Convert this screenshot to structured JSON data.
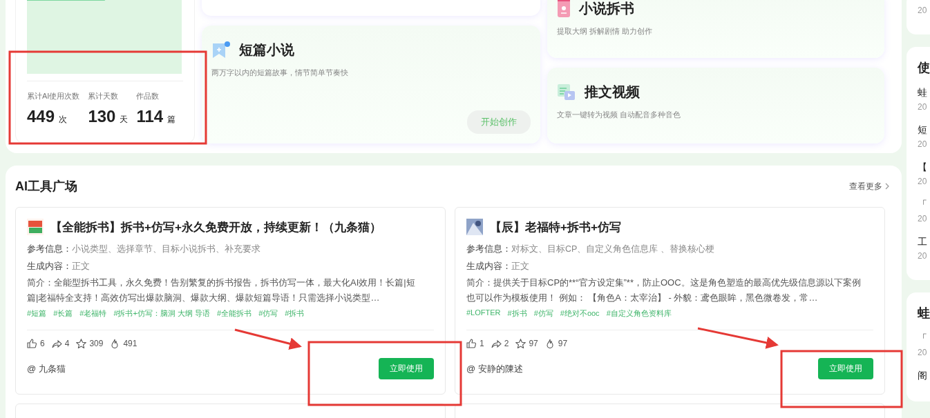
{
  "stats": {
    "items": [
      {
        "label": "累计AI使用次数",
        "value": "449",
        "unit": "次"
      },
      {
        "label": "累计天数",
        "value": "130",
        "unit": "天"
      },
      {
        "label": "作品数",
        "value": "114",
        "unit": "篇"
      }
    ]
  },
  "features": [
    {
      "kind": "short",
      "title": "短篇小说",
      "description": "两万字以内的短篇故事，情节简单节奏快",
      "button": "开始创作"
    },
    {
      "kind": "breakdown",
      "title": "小说拆书",
      "description": "提取大纲 拆解剧情 助力创作"
    },
    {
      "kind": "video",
      "title": "推文视频",
      "description": "文章一键转为视频 自动配音多种音色"
    }
  ],
  "tool_square": {
    "title": "AI工具广场",
    "more": "查看更多",
    "tools": [
      {
        "title": "【全能拆书】拆书+仿写+永久免费开放，持续更新！（九条猫）",
        "reference_label": "参考信息：",
        "reference": "小说类型、选择章节、目标小说拆书、补充要求",
        "output_label": "生成内容：",
        "output": "正文",
        "intro_label": "简介：",
        "intro": "全能型拆书工具，永久免费！告别繁复的拆书报告，拆书仿写一体，最大化AI效用！长篇|短篇|老福特全支持！高效仿写出爆款脑洞、爆款大纲、爆款短篇导语！只需选择小说类型…",
        "tags": [
          "#短篇",
          "#长篇",
          "#老福特",
          "#拆书+仿写：脑洞 大纲 导语",
          "#全能拆书",
          "#仿写",
          "#拆书"
        ],
        "likes": "6",
        "shares": "4",
        "stars": "309",
        "uses": "491",
        "author": "@ 九条猫",
        "button": "立即使用"
      },
      {
        "title": "【辰】老福特+拆书+仿写",
        "reference_label": "参考信息：",
        "reference": "对标文、目标CP、自定义角色信息库 、替换核心梗",
        "output_label": "生成内容：",
        "output": "正文",
        "intro_label": "简介：",
        "intro": "提供关于目标CP的**“官方设定集”**，防止OOC。这是角色塑造的最高优先级信息源以下案例也可以作为模板使用！ 例如： 【角色A：太宰治】 - 外貌：鸢色眼眸，黑色微卷发，常…",
        "tags": [
          "#LOFTER",
          "#拆书",
          "#仿写",
          "#绝对不ooc",
          "#自定义角色资料库"
        ],
        "likes": "1",
        "shares": "2",
        "stars": "97",
        "uses": "97",
        "author": "@ 安静的陳述",
        "button": "立即使用"
      }
    ]
  },
  "sidebar": {
    "panels": [
      {
        "items": [
          {
            "date": "20"
          }
        ]
      },
      {
        "title": "使",
        "items": [
          {
            "title": "蛙",
            "date": "20"
          },
          {
            "title": "短",
            "date": "20"
          },
          {
            "title": "【",
            "date": "20"
          },
          {
            "title": "「",
            "date": "20"
          },
          {
            "title": "工",
            "date": "20"
          }
        ]
      },
      {
        "title": "蛙",
        "items": [
          {
            "title": "「",
            "date": "20"
          },
          {
            "title": "阁"
          }
        ]
      }
    ]
  }
}
